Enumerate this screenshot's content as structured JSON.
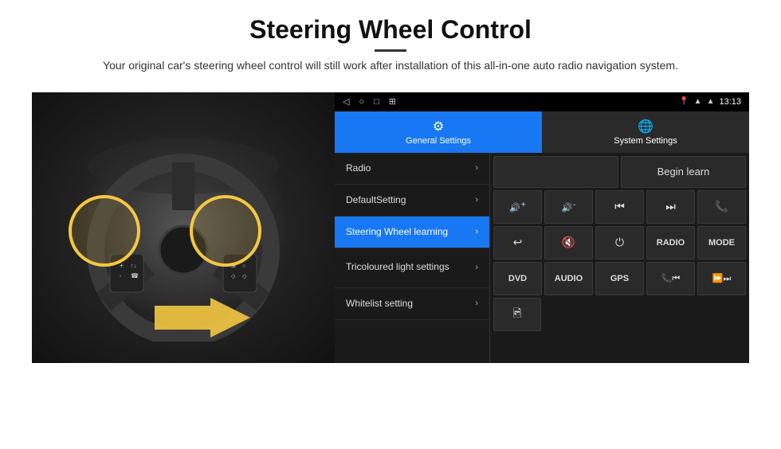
{
  "page": {
    "title": "Steering Wheel Control",
    "subtitle": "Your original car's steering wheel control will still work after installation of this all-in-one auto radio navigation system."
  },
  "status_bar": {
    "time": "13:13",
    "nav_icons": [
      "◁",
      "○",
      "□",
      "⊞"
    ]
  },
  "tabs": [
    {
      "id": "general",
      "label": "General Settings",
      "active": true
    },
    {
      "id": "system",
      "label": "System Settings",
      "active": false
    }
  ],
  "menu_items": [
    {
      "id": "radio",
      "label": "Radio",
      "active": false
    },
    {
      "id": "default",
      "label": "DefaultSetting",
      "active": false
    },
    {
      "id": "steering",
      "label": "Steering Wheel learning",
      "active": true
    },
    {
      "id": "tricolour",
      "label": "Tricoloured light settings",
      "active": false
    },
    {
      "id": "whitelist",
      "label": "Whitelist setting",
      "active": false
    }
  ],
  "controls": {
    "begin_learn": "Begin learn",
    "row2": [
      "🔊+",
      "🔊-",
      "⏮",
      "⏭",
      "📞"
    ],
    "row3": [
      "↩",
      "🔇",
      "⏻",
      "RADIO",
      "MODE"
    ],
    "row4": [
      "DVD",
      "AUDIO",
      "GPS",
      "📞⏮",
      "⏩⏭"
    ],
    "row5": [
      "🖻"
    ]
  },
  "icons": {
    "general_settings": "⚙",
    "system_settings": "🌐",
    "chevron": "›",
    "signal": "▲",
    "wifi": "▲",
    "location": "▲"
  }
}
